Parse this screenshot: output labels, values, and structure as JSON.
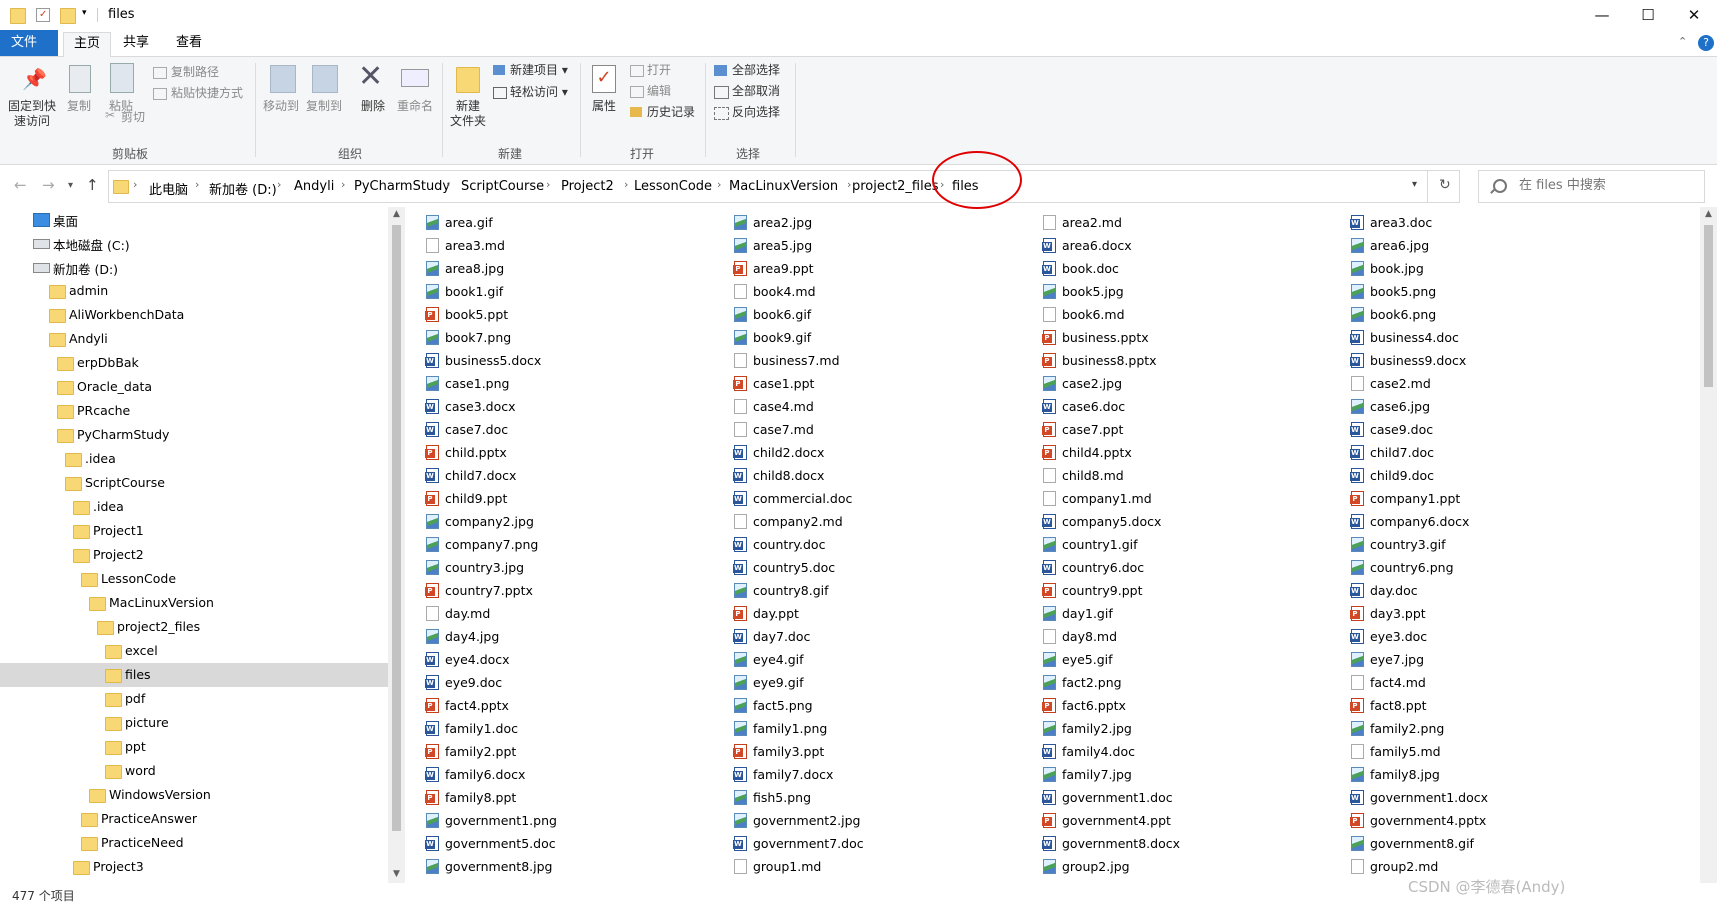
{
  "window": {
    "title": "files",
    "minimize": "—",
    "maximize": "☐",
    "close": "✕"
  },
  "ribbon": {
    "tabs": [
      "文件",
      "主页",
      "共享",
      "查看"
    ],
    "clipboard": {
      "pin": "固定到快\n速访问",
      "copy": "复制",
      "paste": "粘贴",
      "copy_path": "复制路径",
      "paste_shortcut": "粘贴快捷方式",
      "cut": "剪切",
      "group": "剪贴板"
    },
    "organize": {
      "move_to": "移动到",
      "copy_to": "复制到",
      "delete": "删除",
      "rename": "重命名",
      "group": "组织"
    },
    "new": {
      "new_folder": "新建\n文件夹",
      "new_item": "新建项目",
      "easy_access": "轻松访问",
      "group": "新建"
    },
    "open": {
      "properties": "属性",
      "open": "打开",
      "edit": "编辑",
      "history": "历史记录",
      "group": "打开"
    },
    "select": {
      "select_all": "全部选择",
      "select_none": "全部取消",
      "invert": "反向选择",
      "group": "选择"
    }
  },
  "address": {
    "crumbs": [
      "此电脑",
      "新加卷 (D:)",
      "Andyli",
      "PyCharmStudy",
      "ScriptCourse",
      "Project2",
      "LessonCode",
      "MacLinuxVersion",
      "project2_files",
      "files"
    ],
    "search_placeholder": "在 files 中搜索"
  },
  "nav_tree": [
    {
      "label": "桌面",
      "indent": 0,
      "icon": "desktop-icon"
    },
    {
      "label": "本地磁盘 (C:)",
      "indent": 0,
      "icon": "drive-icon"
    },
    {
      "label": "新加卷 (D:)",
      "indent": 0,
      "icon": "drive-icon"
    },
    {
      "label": "admin",
      "indent": 1,
      "icon": "folder-icon"
    },
    {
      "label": "AliWorkbenchData",
      "indent": 1,
      "icon": "folder-icon"
    },
    {
      "label": "Andyli",
      "indent": 1,
      "icon": "folder-icon"
    },
    {
      "label": "erpDbBak",
      "indent": 2,
      "icon": "folder-icon"
    },
    {
      "label": "Oracle_data",
      "indent": 2,
      "icon": "folder-icon"
    },
    {
      "label": "PRcache",
      "indent": 2,
      "icon": "folder-icon"
    },
    {
      "label": "PyCharmStudy",
      "indent": 2,
      "icon": "folder-icon"
    },
    {
      "label": ".idea",
      "indent": 3,
      "icon": "folder-icon"
    },
    {
      "label": "ScriptCourse",
      "indent": 3,
      "icon": "folder-icon"
    },
    {
      "label": ".idea",
      "indent": 4,
      "icon": "folder-icon"
    },
    {
      "label": "Project1",
      "indent": 4,
      "icon": "folder-icon"
    },
    {
      "label": "Project2",
      "indent": 4,
      "icon": "folder-icon"
    },
    {
      "label": "LessonCode",
      "indent": 5,
      "icon": "folder-icon"
    },
    {
      "label": "MacLinuxVersion",
      "indent": 6,
      "icon": "folder-icon"
    },
    {
      "label": "project2_files",
      "indent": 7,
      "icon": "folder-icon"
    },
    {
      "label": "excel",
      "indent": 8,
      "icon": "folder-icon"
    },
    {
      "label": "files",
      "indent": 8,
      "icon": "folder-icon",
      "selected": true
    },
    {
      "label": "pdf",
      "indent": 8,
      "icon": "folder-icon"
    },
    {
      "label": "picture",
      "indent": 8,
      "icon": "folder-icon"
    },
    {
      "label": "ppt",
      "indent": 8,
      "icon": "folder-icon"
    },
    {
      "label": "word",
      "indent": 8,
      "icon": "folder-icon"
    },
    {
      "label": "WindowsVersion",
      "indent": 6,
      "icon": "folder-icon"
    },
    {
      "label": "PracticeAnswer",
      "indent": 5,
      "icon": "folder-icon"
    },
    {
      "label": "PracticeNeed",
      "indent": 5,
      "icon": "folder-icon"
    },
    {
      "label": "Project3",
      "indent": 4,
      "icon": "folder-icon"
    }
  ],
  "files": [
    [
      "area.gif",
      "area3.md",
      "area8.jpg",
      "book1.gif",
      "book5.ppt",
      "book7.png",
      "business5.docx",
      "case1.png",
      "case3.docx",
      "case7.doc",
      "child.pptx",
      "child7.docx",
      "child9.ppt",
      "company2.jpg",
      "company7.png",
      "country3.jpg",
      "country7.pptx",
      "day.md",
      "day4.jpg",
      "eye4.docx",
      "eye9.doc",
      "fact4.pptx",
      "family1.doc",
      "family2.ppt",
      "family6.docx",
      "family8.ppt",
      "government1.png",
      "government5.doc",
      "government8.jpg"
    ],
    [
      "area2.jpg",
      "area5.jpg",
      "area9.ppt",
      "book4.md",
      "book6.gif",
      "book9.gif",
      "business7.md",
      "case1.ppt",
      "case4.md",
      "case7.md",
      "child2.docx",
      "child8.docx",
      "commercial.doc",
      "company2.md",
      "country.doc",
      "country5.doc",
      "country8.gif",
      "day.ppt",
      "day7.doc",
      "eye4.gif",
      "eye9.gif",
      "fact5.png",
      "family1.png",
      "family3.ppt",
      "family7.docx",
      "fish5.png",
      "government2.jpg",
      "government7.doc",
      "group1.md"
    ],
    [
      "area2.md",
      "area6.docx",
      "book.doc",
      "book5.jpg",
      "book6.md",
      "business.pptx",
      "business8.pptx",
      "case2.jpg",
      "case6.doc",
      "case7.ppt",
      "child4.pptx",
      "child8.md",
      "company1.md",
      "company5.docx",
      "country1.gif",
      "country6.doc",
      "country9.ppt",
      "day1.gif",
      "day8.md",
      "eye5.gif",
      "fact2.png",
      "fact6.pptx",
      "family2.jpg",
      "family4.doc",
      "family7.jpg",
      "government1.doc",
      "government4.ppt",
      "government8.docx",
      "group2.jpg"
    ],
    [
      "area3.doc",
      "area6.jpg",
      "book.jpg",
      "book5.png",
      "book6.png",
      "business4.doc",
      "business9.docx",
      "case2.md",
      "case6.jpg",
      "case9.doc",
      "child7.doc",
      "child9.doc",
      "company1.ppt",
      "company6.docx",
      "country3.gif",
      "country6.png",
      "day.doc",
      "day3.ppt",
      "eye3.doc",
      "eye7.jpg",
      "fact4.md",
      "fact8.ppt",
      "family2.png",
      "family5.md",
      "family8.jpg",
      "government1.docx",
      "government4.pptx",
      "government8.gif",
      "group2.md"
    ]
  ],
  "status": {
    "count": "477 个项目"
  },
  "watermark": "CSDN @李德春(Andy)"
}
